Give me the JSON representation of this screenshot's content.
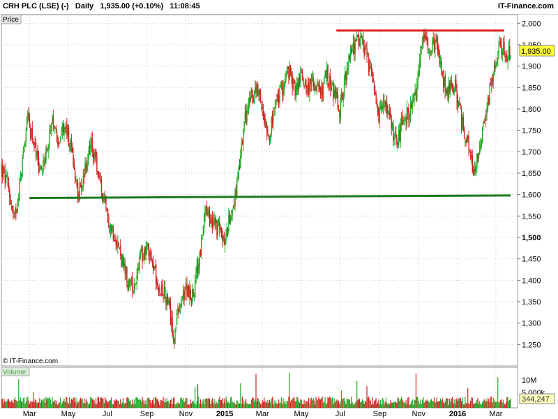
{
  "header": {
    "title": "CRH PLC (LSE) (-)   Daily   1,935.00 (+0.10%)   11:08:45",
    "brand": "IT-Finance.com"
  },
  "panels": {
    "price_label": "Price",
    "volume_label": "Volume",
    "watermark": "© IT-Finance.com"
  },
  "colors": {
    "up": "#22aa22",
    "down": "#cc2222",
    "support_line": "#1a7a1a",
    "resistance_line": "#e02020",
    "price_tag_bg": "#ffff33",
    "volume_tag_bg": "#ffffc0",
    "grid": "#c8c8c8"
  },
  "chart_data": {
    "type": "candlestick",
    "series_name": "CRH PLC (LSE)",
    "interval": "Daily",
    "last_price": "1,935.00",
    "last_volume": "344,247",
    "change": "+0.10%",
    "time": "11:08:45",
    "ylim": [
      1200,
      2020
    ],
    "y_ticks": [
      1250,
      1300,
      1350,
      1400,
      1450,
      1500,
      1550,
      1600,
      1650,
      1700,
      1750,
      1800,
      1850,
      1900,
      1950,
      2000
    ],
    "y_tick_labels": [
      "1,250",
      "1,300",
      "1,350",
      "1,400",
      "1,450",
      "1,500",
      "1,550",
      "1,600",
      "1,650",
      "1,700",
      "1,750",
      "1,800",
      "1,850",
      "1,900",
      "1,950",
      "2,000"
    ],
    "x_labels": [
      {
        "label": "Mar",
        "date": "2014-03-01"
      },
      {
        "label": "May",
        "date": "2014-05-01"
      },
      {
        "label": "Jul",
        "date": "2014-07-01"
      },
      {
        "label": "Sep",
        "date": "2014-09-01"
      },
      {
        "label": "Nov",
        "date": "2014-11-01"
      },
      {
        "label": "2015",
        "date": "2015-01-01",
        "bold": true
      },
      {
        "label": "Mar",
        "date": "2015-03-01"
      },
      {
        "label": "May",
        "date": "2015-05-01"
      },
      {
        "label": "Jul",
        "date": "2015-07-01"
      },
      {
        "label": "Sep",
        "date": "2015-09-01"
      },
      {
        "label": "Nov",
        "date": "2015-11-01"
      },
      {
        "label": "2016",
        "date": "2016-01-01",
        "bold": true
      },
      {
        "label": "Mar",
        "date": "2016-03-01"
      }
    ],
    "x_range": [
      "2014-01-16",
      "2016-03-24"
    ],
    "price_path": [
      [
        "2014-01-16",
        1660
      ],
      [
        "2014-01-26",
        1620
      ],
      [
        "2014-02-05",
        1540
      ],
      [
        "2014-02-15",
        1640
      ],
      [
        "2014-02-25",
        1780
      ],
      [
        "2014-03-07",
        1730
      ],
      [
        "2014-03-17",
        1650
      ],
      [
        "2014-03-27",
        1700
      ],
      [
        "2014-04-06",
        1760
      ],
      [
        "2014-04-16",
        1730
      ],
      [
        "2014-04-26",
        1760
      ],
      [
        "2014-05-06",
        1700
      ],
      [
        "2014-05-16",
        1600
      ],
      [
        "2014-05-26",
        1650
      ],
      [
        "2014-06-05",
        1720
      ],
      [
        "2014-06-15",
        1660
      ],
      [
        "2014-06-25",
        1580
      ],
      [
        "2014-07-05",
        1530
      ],
      [
        "2014-07-15",
        1500
      ],
      [
        "2014-07-25",
        1440
      ],
      [
        "2014-08-04",
        1380
      ],
      [
        "2014-08-14",
        1400
      ],
      [
        "2014-08-24",
        1460
      ],
      [
        "2014-09-03",
        1480
      ],
      [
        "2014-09-13",
        1420
      ],
      [
        "2014-09-23",
        1380
      ],
      [
        "2014-10-03",
        1350
      ],
      [
        "2014-10-13",
        1270
      ],
      [
        "2014-10-23",
        1340
      ],
      [
        "2014-11-02",
        1380
      ],
      [
        "2014-11-12",
        1360
      ],
      [
        "2014-11-22",
        1450
      ],
      [
        "2014-12-02",
        1560
      ],
      [
        "2014-12-12",
        1530
      ],
      [
        "2014-12-22",
        1520
      ],
      [
        "2015-01-01",
        1490
      ],
      [
        "2015-01-11",
        1560
      ],
      [
        "2015-01-21",
        1620
      ],
      [
        "2015-01-31",
        1760
      ],
      [
        "2015-02-10",
        1830
      ],
      [
        "2015-02-20",
        1840
      ],
      [
        "2015-03-02",
        1790
      ],
      [
        "2015-03-12",
        1740
      ],
      [
        "2015-03-22",
        1810
      ],
      [
        "2015-04-01",
        1850
      ],
      [
        "2015-04-11",
        1890
      ],
      [
        "2015-04-21",
        1840
      ],
      [
        "2015-05-01",
        1880
      ],
      [
        "2015-05-11",
        1850
      ],
      [
        "2015-05-21",
        1860
      ],
      [
        "2015-05-31",
        1830
      ],
      [
        "2015-06-10",
        1880
      ],
      [
        "2015-06-20",
        1840
      ],
      [
        "2015-06-30",
        1800
      ],
      [
        "2015-07-10",
        1880
      ],
      [
        "2015-07-20",
        1940
      ],
      [
        "2015-07-30",
        1960
      ],
      [
        "2015-08-09",
        1930
      ],
      [
        "2015-08-19",
        1870
      ],
      [
        "2015-08-29",
        1780
      ],
      [
        "2015-09-08",
        1820
      ],
      [
        "2015-09-18",
        1760
      ],
      [
        "2015-09-28",
        1720
      ],
      [
        "2015-10-08",
        1780
      ],
      [
        "2015-10-18",
        1790
      ],
      [
        "2015-10-28",
        1830
      ],
      [
        "2015-11-07",
        1970
      ],
      [
        "2015-11-17",
        1950
      ],
      [
        "2015-11-27",
        1960
      ],
      [
        "2015-12-07",
        1880
      ],
      [
        "2015-12-17",
        1840
      ],
      [
        "2015-12-27",
        1860
      ],
      [
        "2016-01-06",
        1780
      ],
      [
        "2016-01-16",
        1720
      ],
      [
        "2016-01-26",
        1650
      ],
      [
        "2016-02-05",
        1720
      ],
      [
        "2016-02-15",
        1800
      ],
      [
        "2016-02-25",
        1880
      ],
      [
        "2016-03-06",
        1950
      ],
      [
        "2016-03-16",
        1930
      ],
      [
        "2016-03-24",
        1935
      ]
    ],
    "support_line": {
      "from": [
        "2014-03-01",
        1592
      ],
      "to": [
        "2016-03-24",
        1598
      ]
    },
    "resistance_line": {
      "from": [
        "2015-06-25",
        1983
      ],
      "to": [
        "2016-03-14",
        1983
      ]
    },
    "volume_ticks": [
      "10M",
      "5,000k"
    ]
  }
}
